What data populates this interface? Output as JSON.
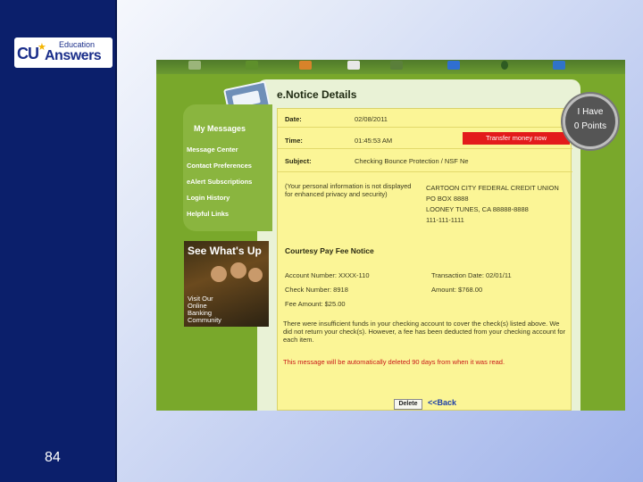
{
  "logo": {
    "cu": "CU",
    "education": "Education",
    "answers": "Answers"
  },
  "slide": {
    "number": "84"
  },
  "page": {
    "title": "e.Notice Details",
    "sidebar": {
      "title": "My Messages",
      "items": [
        "Message Center",
        "Contact Preferences",
        "eAlert Subscriptions",
        "Login History",
        "Helpful Links"
      ]
    },
    "ad": {
      "title": "See What's Up",
      "text": "Visit Our\nOnline\nBanking\nCommunity"
    },
    "notice": {
      "date_label": "Date:",
      "date_value": "02/08/2011",
      "time_label": "Time:",
      "time_value": "01:45:53 AM",
      "transfer_button": "Transfer money now",
      "subject_label": "Subject:",
      "subject_value": "Checking Bounce Protection / NSF Ne",
      "privacy_text": "(Your personal information is not displayed for enhanced privacy and security)",
      "address": [
        "CARTOON CITY FEDERAL CREDIT UNION",
        "PO BOX 8888",
        "LOONEY TUNES, CA 88888-8888",
        "111-111-1111"
      ],
      "section_title": "Courtesy Pay Fee Notice",
      "account_number": "Account Number: XXXX-110",
      "transaction_date": "Transaction Date: 02/01/11",
      "check_number": "Check Number: 8918",
      "amount": "Amount: $768.00",
      "fee_amount": "Fee Amount: $25.00",
      "body": "There were insufficient funds in your checking account to cover the check(s) listed above. We did not return your check(s). However, a fee has been deducted from your checking account for each item.",
      "retention_note": "This message will be automatically deleted 90 days from when it was read.",
      "delete_button": "Delete",
      "back_link": "<<Back"
    }
  },
  "points_badge": {
    "line1": "I Have",
    "line2": "0 Points"
  },
  "colors": {
    "left_band": "#0b1f6b",
    "green": "#79a82b",
    "form_yellow": "#fbf596",
    "transfer_red": "#e31b1b"
  }
}
